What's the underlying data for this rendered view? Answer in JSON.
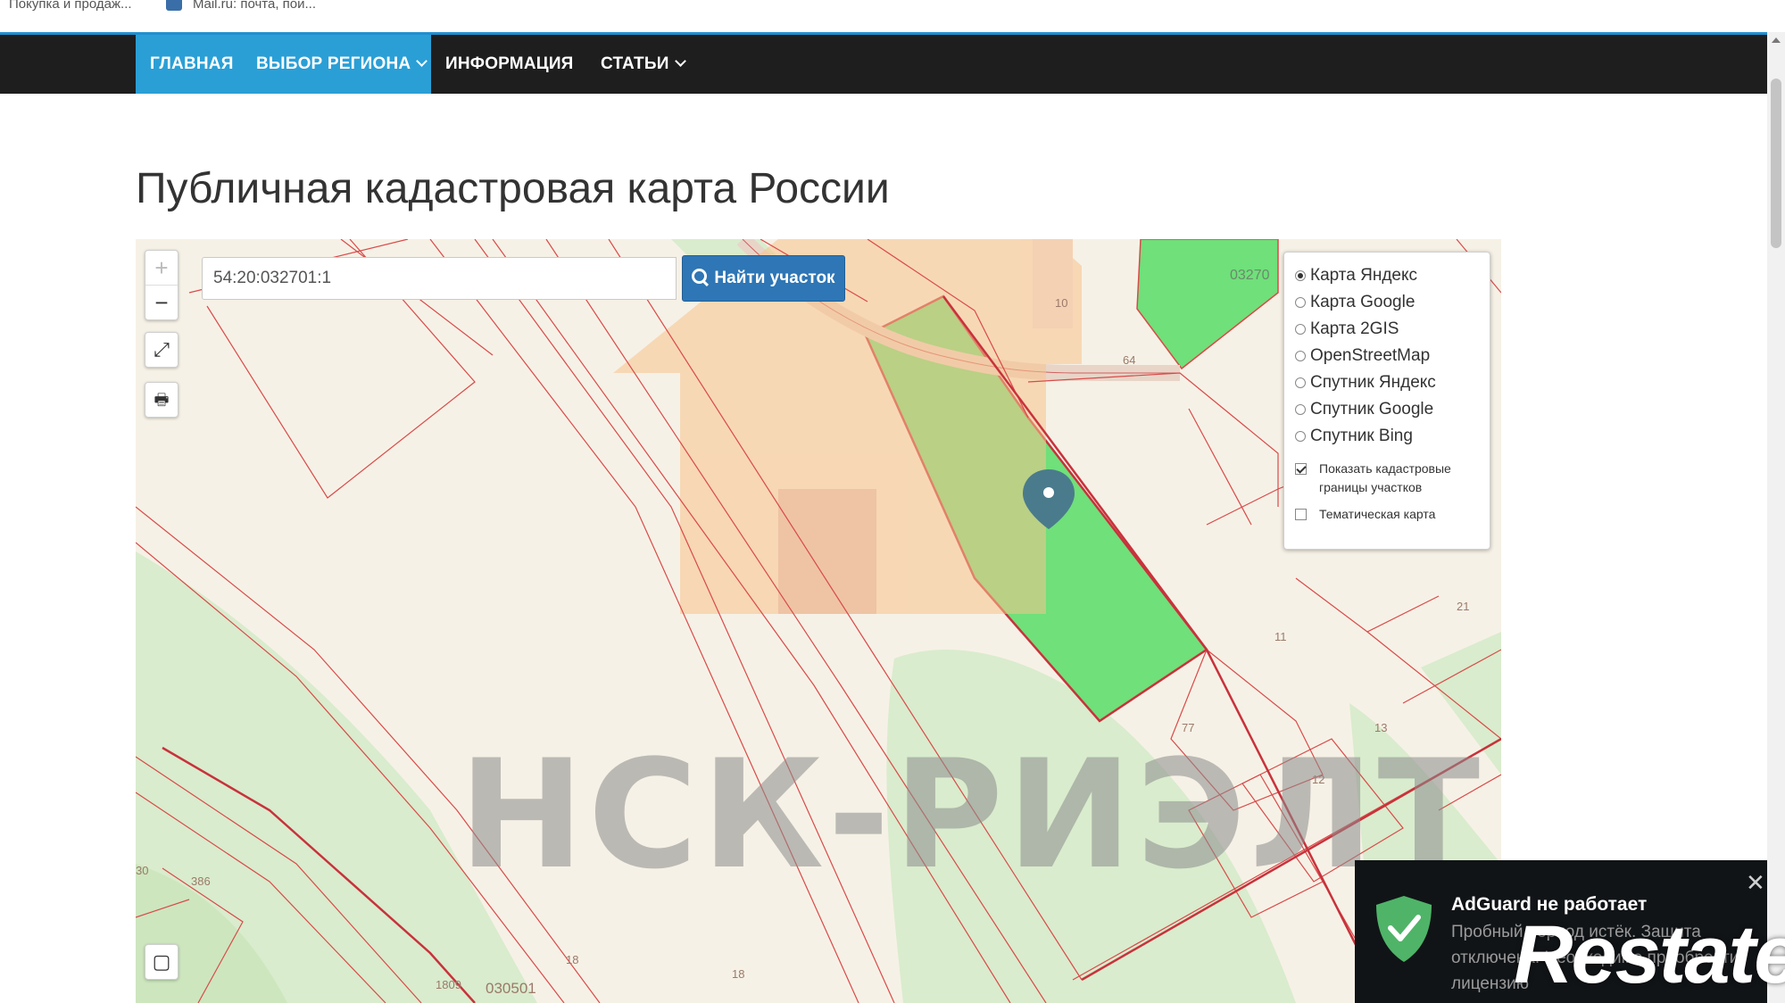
{
  "bookmarks": [
    {
      "label": "Покупка и продаж..."
    },
    {
      "label": "Mail.ru: почта, пои..."
    }
  ],
  "nav": {
    "items": [
      {
        "label": "ГЛАВНАЯ"
      },
      {
        "label": "ВЫБОР РЕГИОНА"
      },
      {
        "label": "ИНФОРМАЦИЯ"
      },
      {
        "label": "СТАТЬИ"
      }
    ],
    "active_color": "#2a9fd6"
  },
  "page": {
    "title": "Публичная кадастровая карта России"
  },
  "map": {
    "search": {
      "value": "54:20:032701:1",
      "button": "Найти участок"
    },
    "controls": {
      "zoom_in": "+",
      "zoom_out": "−"
    },
    "layers": [
      {
        "label": "Карта Яндекс",
        "selected": true
      },
      {
        "label": "Карта Google",
        "selected": false
      },
      {
        "label": "Карта 2GIS",
        "selected": false
      },
      {
        "label": "OpenStreetMap",
        "selected": false
      },
      {
        "label": "Спутник Яндекс",
        "selected": false
      },
      {
        "label": "Спутник Google",
        "selected": false
      },
      {
        "label": "Спутник Bing",
        "selected": false
      }
    ],
    "options": [
      {
        "label": "Показать кадастровые границы участков",
        "checked": true
      },
      {
        "label": "Тематическая карта",
        "checked": false
      }
    ],
    "labels": {
      "quarter_top": "03270",
      "l10": "10",
      "l64": "64",
      "l11": "11",
      "l21": "21",
      "l77": "77",
      "l13": "13",
      "l12": "12",
      "l386": "386",
      "l18a": "18",
      "l18b": "18",
      "l1809": "1809",
      "l030501": "030501",
      "l30": "30"
    },
    "watermark": "НСК-РИЭЛТ",
    "parcel_color": "#6fe07a"
  },
  "adguard": {
    "title": "AdGuard не работает",
    "text": "Пробный период истёк. Защита отключена. Необходимо приобрести лицензию"
  },
  "brand": {
    "restate": "Restate"
  }
}
